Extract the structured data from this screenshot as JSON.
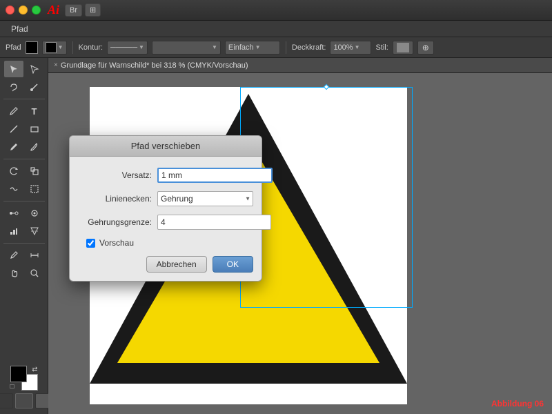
{
  "app": {
    "name": "Ai",
    "title": "Adobe Illustrator"
  },
  "titlebar": {
    "br_label": "Br",
    "view_label": "⊞"
  },
  "menubar": {
    "items": [
      "Pfad"
    ]
  },
  "toolbar": {
    "label_pfad": "Pfad",
    "label_kontur": "Kontur:",
    "stroke_style": "Einfach",
    "deckkraft_label": "Deckkraft:",
    "deckkraft_value": "100%",
    "stil_label": "Stil:"
  },
  "tab": {
    "title": "Grundlage für Warnschild* bei 318 % (CMYK/Vorschau)"
  },
  "dialog": {
    "title": "Pfad verschieben",
    "versatz_label": "Versatz:",
    "versatz_value": "1 mm",
    "linienecken_label": "Linienecken:",
    "linienecken_value": "Gehrung",
    "gehrungsgrenze_label": "Gehrungsgrenze:",
    "gehrungsgrenze_value": "4",
    "preview_label": "Vorschau",
    "cancel_label": "Abbrechen",
    "ok_label": "OK"
  },
  "abbildung": {
    "label": "Abbildung 06"
  },
  "tools": [
    {
      "name": "select",
      "icon": "↖"
    },
    {
      "name": "direct-select",
      "icon": "↗"
    },
    {
      "name": "pen",
      "icon": "✒"
    },
    {
      "name": "type",
      "icon": "T"
    },
    {
      "name": "shape",
      "icon": "▭"
    },
    {
      "name": "pencil",
      "icon": "✏"
    },
    {
      "name": "rotate",
      "icon": "↻"
    },
    {
      "name": "scale",
      "icon": "⤡"
    },
    {
      "name": "blend",
      "icon": "∞"
    },
    {
      "name": "eyedropper",
      "icon": "✆"
    },
    {
      "name": "gradient",
      "icon": "■"
    },
    {
      "name": "zoom",
      "icon": "🔍"
    },
    {
      "name": "hand",
      "icon": "✋"
    }
  ]
}
